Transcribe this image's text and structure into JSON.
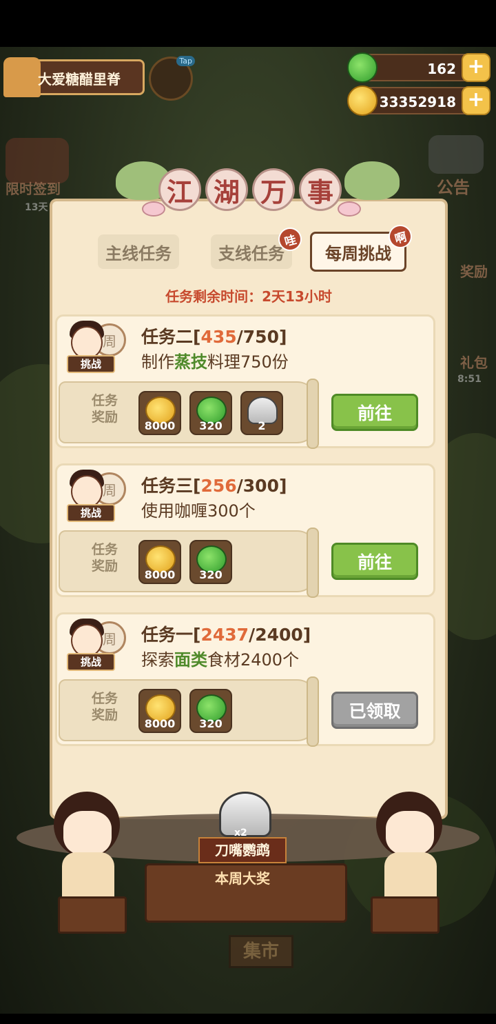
{
  "player": {
    "name": "大爱糖醋里脊"
  },
  "tap_label": "Tap",
  "resources": {
    "apples": "162",
    "coins": "33352918"
  },
  "side_labels": {
    "sign_in": "限时签到",
    "sign_in_days": "13天",
    "notice": "公告",
    "reward": "奖励",
    "gift_pack": "礼包",
    "gift_timer": "8:51"
  },
  "panel": {
    "title": [
      "江",
      "湖",
      "万",
      "事"
    ],
    "tabs": [
      {
        "label": "主线任务",
        "badge": ""
      },
      {
        "label": "支线任务",
        "badge": "哇"
      },
      {
        "label": "每周挑战",
        "badge": "啊"
      }
    ],
    "timer_text": "任务剩余时间：2天13小时",
    "reward_label": "任务奖励",
    "week_char": "周",
    "challenge_tag": "挑战",
    "tasks": [
      {
        "name": "任务二",
        "progress": "435",
        "target": "750",
        "desc_pre": "制作",
        "desc_hl": "蒸技",
        "desc_post": "料理750份",
        "rewards": [
          {
            "icon": "coin-icon",
            "count": "8000"
          },
          {
            "icon": "apple-icon",
            "count": "320"
          },
          {
            "icon": "rice-ball-icon",
            "count": "2"
          }
        ],
        "button": "前往"
      },
      {
        "name": "任务三",
        "progress": "256",
        "target": "300",
        "desc_pre": "使用咖喱300个",
        "desc_hl": "",
        "desc_post": "",
        "rewards": [
          {
            "icon": "coin-icon",
            "count": "8000"
          },
          {
            "icon": "apple-icon",
            "count": "320"
          }
        ],
        "button": "前往"
      },
      {
        "name": "任务一",
        "progress": "2437",
        "target": "2400",
        "desc_pre": "探索",
        "desc_hl": "面类",
        "desc_post": "食材2400个",
        "rewards": [
          {
            "icon": "coin-icon",
            "count": "8000"
          },
          {
            "icon": "apple-icon",
            "count": "320"
          }
        ],
        "button": "已领取"
      }
    ]
  },
  "grand_prize": {
    "multiplier": "x2",
    "name": "刀嘴鹦鹉",
    "label": "本周大奖"
  },
  "market_label": "集市",
  "colors": {
    "accent_green": "#88c24a",
    "progress_orange": "#e06a3a",
    "timer_red": "#c74a2e",
    "claimed_gray": "#a2a2a2"
  }
}
